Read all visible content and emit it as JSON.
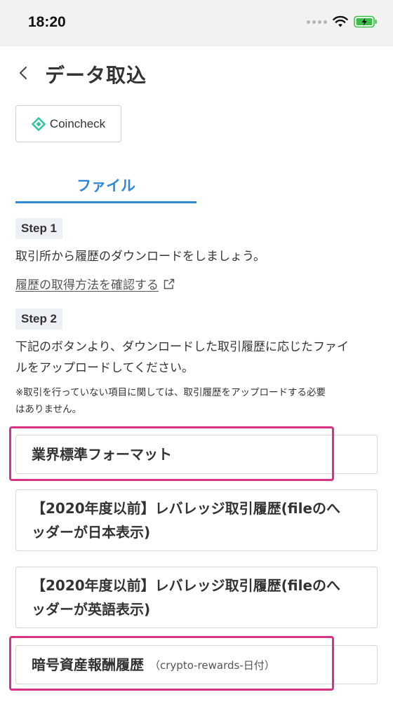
{
  "status_bar": {
    "time": "18:20"
  },
  "header": {
    "title": "データ取込"
  },
  "exchange": {
    "name": "Coincheck",
    "brand_color": "#2ec4a0"
  },
  "tabs": [
    {
      "label": "ファイル",
      "active": true
    }
  ],
  "accent_color": "#2f8ad6",
  "highlight_color": "#d63384",
  "step1": {
    "badge": "Step 1",
    "text": "取引所から履歴のダウンロードをしましょう。",
    "link": "履歴の取得方法を確認する"
  },
  "step2": {
    "badge": "Step 2",
    "text_line1": "下記のボタンより、ダウンロードした取引履歴に応じたファイ",
    "text_line2": "ルをアップロードしてください。",
    "note_line1": "※取引を行っていない項目に関しては、取引履歴をアップロードする必要",
    "note_line2": "はありません。"
  },
  "upload_options": [
    {
      "label": "業界標準フォーマット"
    },
    {
      "label_line1": "【2020年度以前】レバレッジ取引履歴(fileのへ",
      "label_line2": "ッダーが日本表示)"
    },
    {
      "label_line1": "【2020年度以前】レバレッジ取引履歴(fileのへ",
      "label_line2": "ッダーが英語表示)"
    },
    {
      "label": "暗号資産報酬履歴",
      "sublabel": "（crypto-rewards-日付）"
    }
  ]
}
